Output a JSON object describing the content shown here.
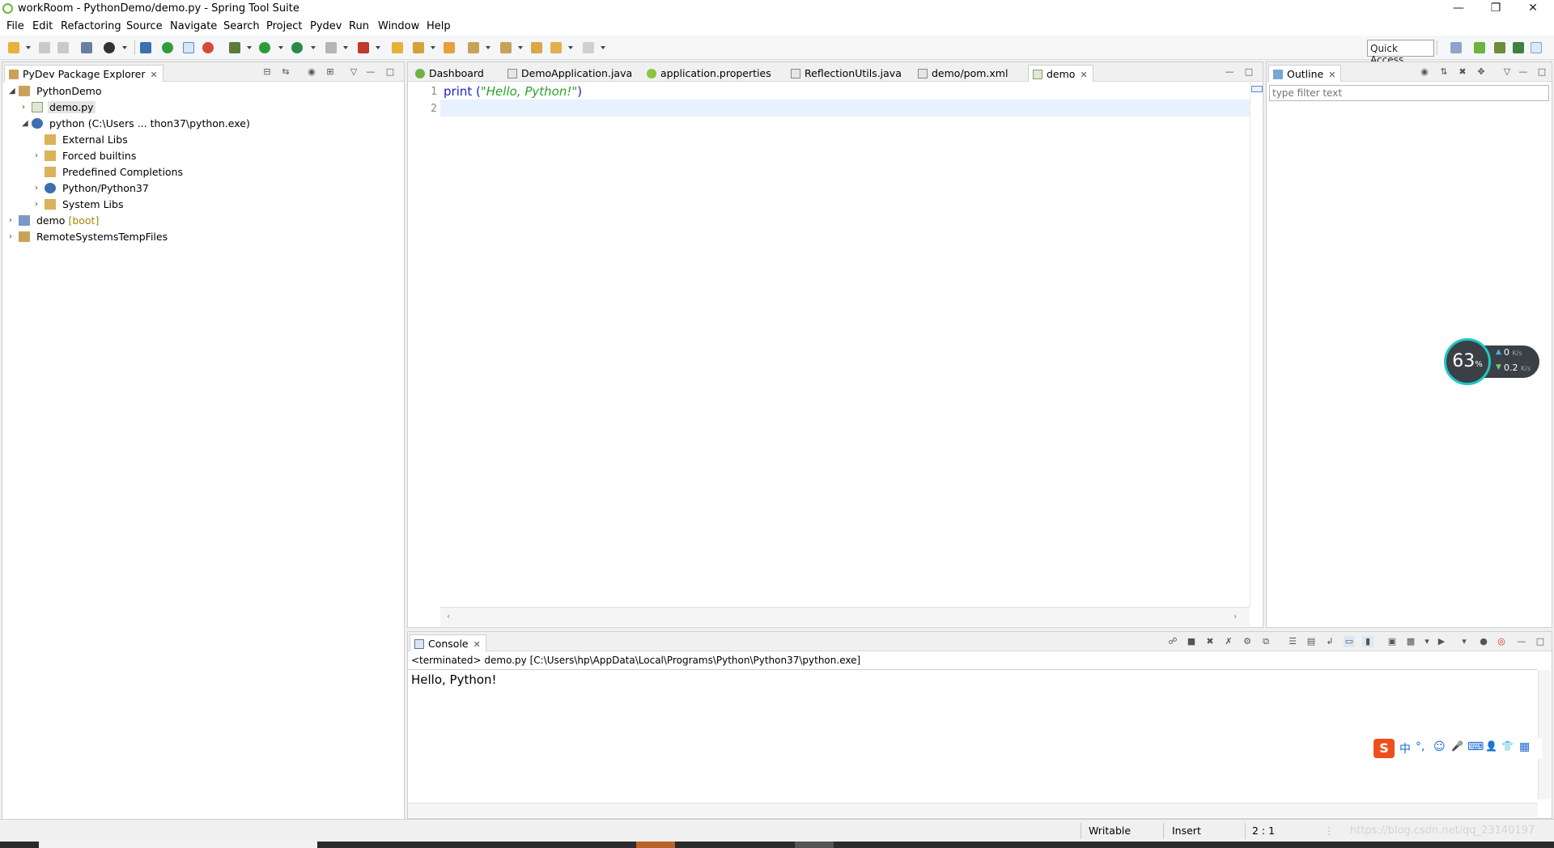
{
  "window": {
    "title": "workRoom - PythonDemo/demo.py - Spring Tool Suite"
  },
  "menu": [
    "File",
    "Edit",
    "Refactoring",
    "Source",
    "Navigate",
    "Search",
    "Project",
    "Pydev",
    "Run",
    "Window",
    "Help"
  ],
  "toolbar": {
    "quick_access": "Quick Access"
  },
  "explorer": {
    "title": "PyDev Package Explorer",
    "tree": [
      {
        "label": "PythonDemo",
        "extra": ""
      },
      {
        "label": "demo.py",
        "extra": ""
      },
      {
        "label": "python  (C:\\Users ... thon37\\python.exe)",
        "extra": ""
      },
      {
        "label": "External Libs",
        "extra": ""
      },
      {
        "label": "Forced builtins",
        "extra": ""
      },
      {
        "label": "Predefined Completions",
        "extra": ""
      },
      {
        "label": "Python/Python37",
        "extra": ""
      },
      {
        "label": "System Libs",
        "extra": ""
      },
      {
        "label": "demo",
        "extra": "[boot]"
      },
      {
        "label": "RemoteSystemsTempFiles",
        "extra": ""
      }
    ]
  },
  "editor": {
    "tabs": [
      "Dashboard",
      "DemoApplication.java",
      "application.properties",
      "ReflectionUtils.java",
      "demo/pom.xml",
      "demo"
    ],
    "line_numbers": [
      "1",
      "2"
    ],
    "code": {
      "keyword": "print",
      "open": " (",
      "string": "\"Hello, Python!\"",
      "close": ")"
    }
  },
  "outline": {
    "title": "Outline",
    "filter_placeholder": "type filter text"
  },
  "console": {
    "title": "Console",
    "header": "<terminated> demo.py [C:\\Users\\hp\\AppData\\Local\\Programs\\Python\\Python37\\python.exe]",
    "output": "Hello, Python!"
  },
  "status": {
    "writable": "Writable",
    "insert": "Insert",
    "position": "2 : 1",
    "watermark": "https://blog.csdn.net/qq_23140197"
  },
  "net_monitor": {
    "percent": "63",
    "percent_unit": "%",
    "up": "0",
    "down": "0.2",
    "unit": "K/s"
  },
  "ime": {
    "logo": "S",
    "glyphs": [
      "中",
      "°,",
      "☺",
      "🎤",
      "⌨",
      "👤",
      "👕",
      "▦"
    ]
  },
  "colors": {
    "keyword": "#2020d0",
    "string": "#29a329",
    "accent": "#1ec8c0"
  }
}
